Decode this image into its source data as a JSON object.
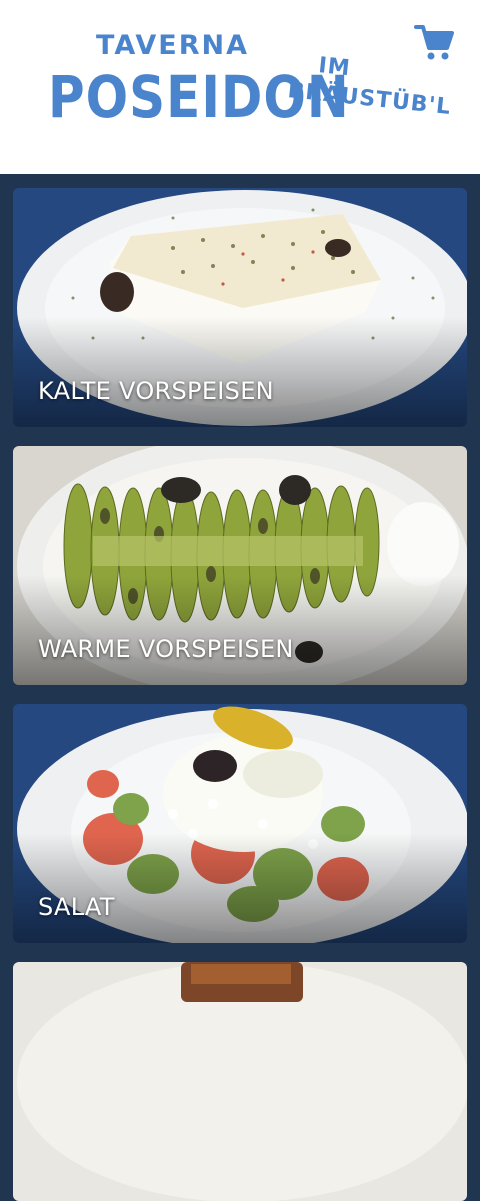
{
  "header": {
    "logo_line1": "TAVERNA",
    "logo_line2": "POSEIDON",
    "sub_line1": "IM",
    "sub_line2": "BRÄUSTÜB'L",
    "brand_color": "#4a84cc",
    "cart_icon": "shopping-cart-icon"
  },
  "categories": [
    {
      "title": "KALTE VORSPEISEN"
    },
    {
      "title": "WARME VORSPEISEN"
    },
    {
      "title": "SALAT"
    },
    {
      "title": ""
    }
  ]
}
